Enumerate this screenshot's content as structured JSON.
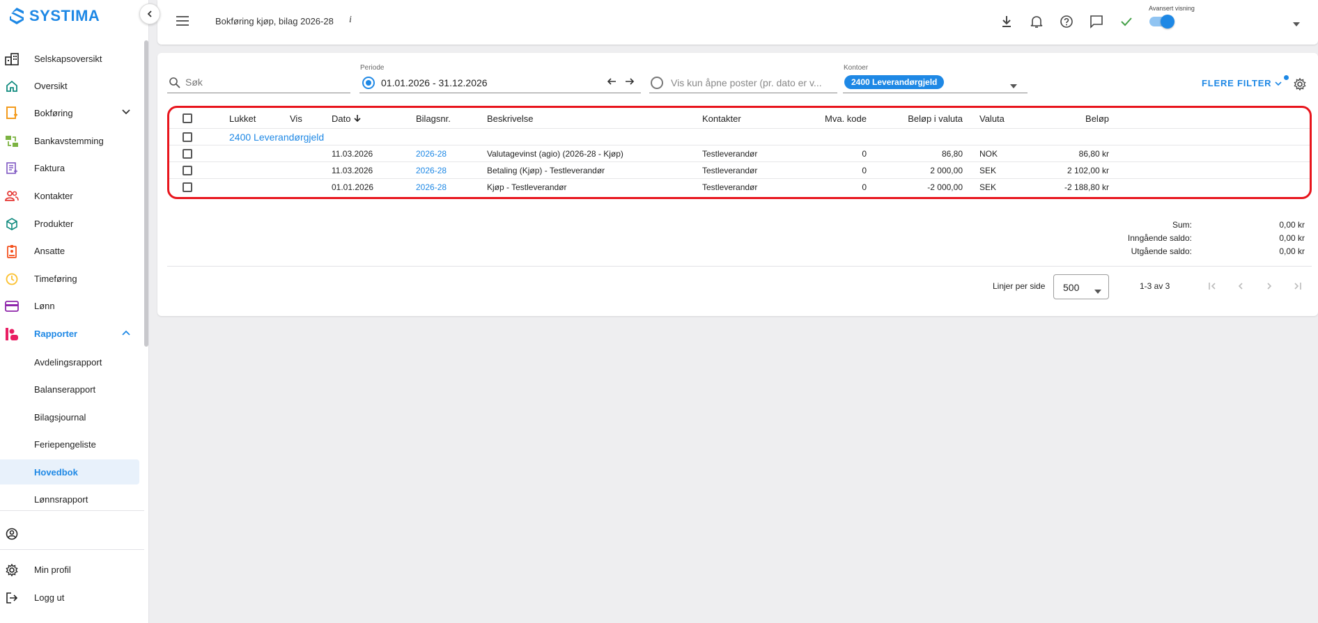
{
  "brand": {
    "name": "SYSTIMA",
    "accent": "#1e88e5"
  },
  "sidebar": {
    "items": [
      {
        "label": "Selskapsoversikt",
        "icon": "company-icon"
      },
      {
        "label": "Oversikt",
        "icon": "home-icon"
      },
      {
        "label": "Bokføring",
        "icon": "bookkeeping-icon"
      },
      {
        "label": "Bankavstemming",
        "icon": "bank-icon"
      },
      {
        "label": "Faktura",
        "icon": "invoice-icon"
      },
      {
        "label": "Kontakter",
        "icon": "contacts-icon"
      },
      {
        "label": "Produkter",
        "icon": "products-icon"
      },
      {
        "label": "Ansatte",
        "icon": "employees-icon"
      },
      {
        "label": "Timeføring",
        "icon": "clock-icon"
      },
      {
        "label": "Lønn",
        "icon": "payroll-icon"
      },
      {
        "label": "Rapporter",
        "icon": "reports-icon"
      }
    ],
    "subitems": [
      {
        "label": "Avdelingsrapport"
      },
      {
        "label": "Balanserapport"
      },
      {
        "label": "Bilagsjournal"
      },
      {
        "label": "Feriepengeliste"
      },
      {
        "label": "Hovedbok"
      },
      {
        "label": "Lønnsrapport"
      }
    ],
    "bottom": [
      {
        "label": "Min profil",
        "icon": "gear-icon"
      },
      {
        "label": "Logg ut",
        "icon": "logout-icon"
      }
    ]
  },
  "topbar": {
    "title": "Bokføring kjøp, bilag 2026-28",
    "info": "i",
    "advanced_label": "Avansert visning",
    "advanced_on": true
  },
  "filters": {
    "search_placeholder": "Søk",
    "period_label": "Periode",
    "period_value": "01.01.2026 - 31.12.2026",
    "open_posts_label": "Vis kun åpne poster (pr. dato er v...",
    "accounts_label": "Kontoer",
    "accounts_chip": "2400 Leverandørgjeld",
    "more_filters": "FLERE FILTER"
  },
  "table": {
    "headers": {
      "lukket": "Lukket",
      "vis": "Vis",
      "dato": "Dato",
      "bilagsnr": "Bilagsnr.",
      "beskrivelse": "Beskrivelse",
      "kontakter": "Kontakter",
      "mva": "Mva. kode",
      "belop_valuta": "Beløp i valuta",
      "valuta": "Valuta",
      "belop": "Beløp"
    },
    "group_label": "2400 Leverandørgjeld",
    "rows": [
      {
        "dato": "11.03.2026",
        "bilagsnr": "2026-28",
        "beskrivelse": "Valutagevinst (agio) (2026-28 - Kjøp)",
        "kontakter": "Testleverandør",
        "mva": "0",
        "belop_valuta": "86,80",
        "valuta": "NOK",
        "belop": "86,80 kr"
      },
      {
        "dato": "11.03.2026",
        "bilagsnr": "2026-28",
        "beskrivelse": "Betaling (Kjøp) - Testleverandør",
        "kontakter": "Testleverandør",
        "mva": "0",
        "belop_valuta": "2 000,00",
        "valuta": "SEK",
        "belop": "2 102,00 kr"
      },
      {
        "dato": "01.01.2026",
        "bilagsnr": "2026-28",
        "beskrivelse": "Kjøp - Testleverandør",
        "kontakter": "Testleverandør",
        "mva": "0",
        "belop_valuta": "-2 000,00",
        "valuta": "SEK",
        "belop": "-2 188,80 kr"
      }
    ]
  },
  "summary": {
    "sum_label": "Sum:",
    "sum_value": "0,00 kr",
    "opening_label": "Inngående saldo:",
    "opening_value": "0,00 kr",
    "closing_label": "Utgående saldo:",
    "closing_value": "0,00 kr"
  },
  "pagination": {
    "rows_per_page_label": "Linjer per side",
    "rows_per_page": "500",
    "range": "1-3 av 3"
  }
}
